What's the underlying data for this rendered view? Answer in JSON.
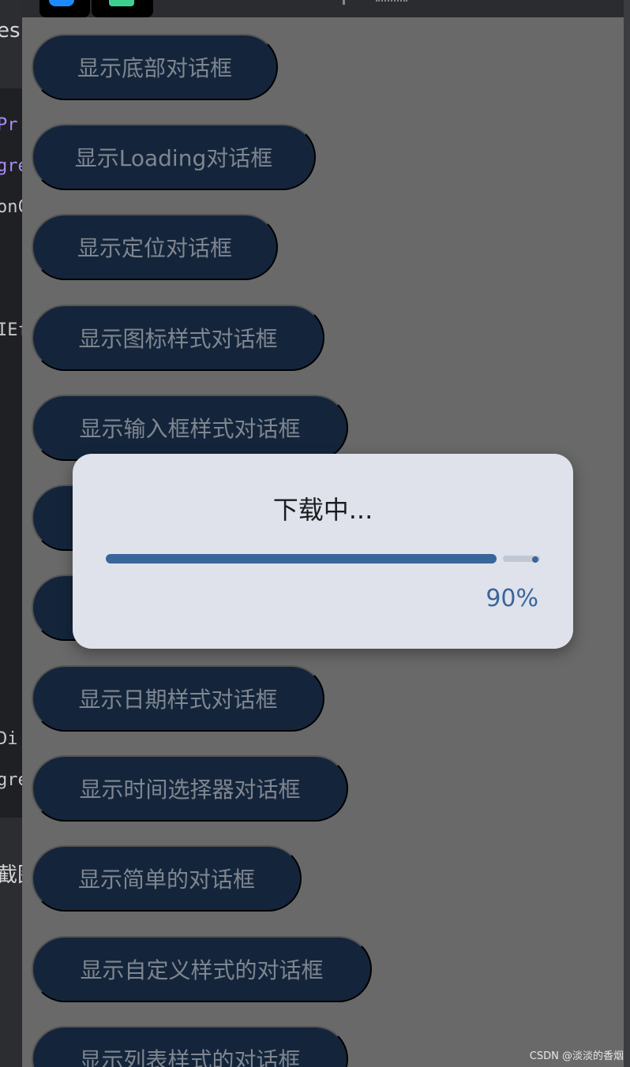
{
  "ide": {
    "fragments": [
      "es",
      "Pr",
      "gre",
      "onC",
      "IEf",
      "Di",
      "gre",
      "截图"
    ]
  },
  "buttons": [
    {
      "label": "显示底部对话框"
    },
    {
      "label": "显示Loading对话框"
    },
    {
      "label": "显示定位对话框"
    },
    {
      "label": "显示图标样式对话框"
    },
    {
      "label": "显示输入框样式对话框"
    },
    {
      "label": ""
    },
    {
      "label": ""
    },
    {
      "label": "显示日期样式对话框"
    },
    {
      "label": "显示时间选择器对话框"
    },
    {
      "label": "显示简单的对话框"
    },
    {
      "label": "显示自定义样式的对话框"
    },
    {
      "label": "显示列表样式的对话框"
    }
  ],
  "dialog": {
    "title": "下载中...",
    "progress": 0.9,
    "percent_text": "90%"
  },
  "colors": {
    "button_bg": "#14253b",
    "accent": "#3a659b",
    "dialog_bg": "#dfe2eb",
    "scrim": "#696969"
  },
  "watermark": "CSDN @淡淡的香烟"
}
